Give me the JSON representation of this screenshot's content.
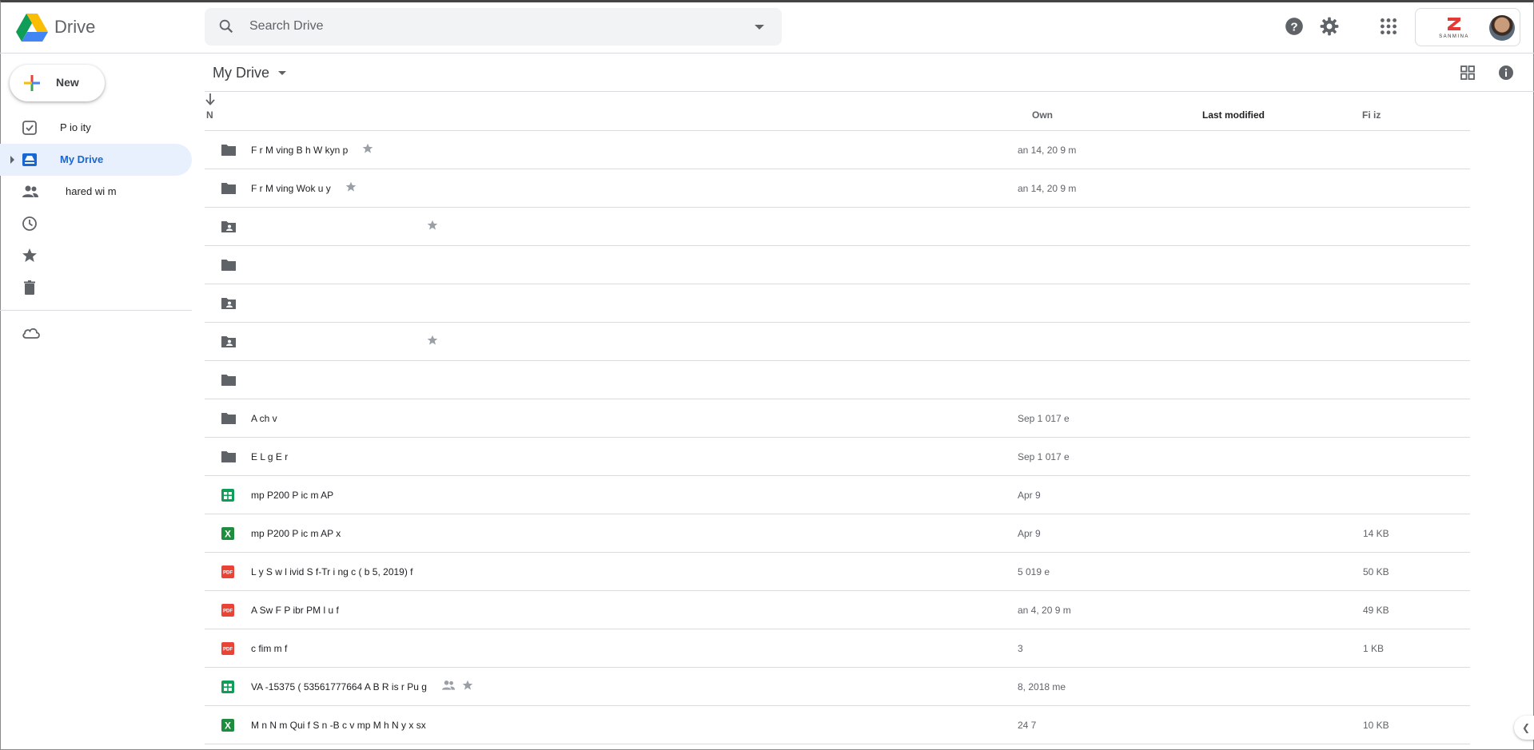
{
  "app": {
    "name": "Drive"
  },
  "search": {
    "placeholder": "Search Drive"
  },
  "header": {
    "icons": [
      "help-icon",
      "settings-icon",
      "apps-grid-icon"
    ],
    "account": {
      "org_logo_text": "SANMINA"
    }
  },
  "sidebar": {
    "new_label": "New",
    "items": [
      {
        "label": "P io ity",
        "icon": "priority-check-icon",
        "active": false
      },
      {
        "label": "My Drive",
        "icon": "my-drive-icon",
        "active": true
      },
      {
        "label": "hared wi m",
        "icon": "shared-people-icon",
        "active": false
      },
      {
        "label": "",
        "icon": "recent-clock-icon",
        "active": false
      },
      {
        "label": "",
        "icon": "starred-icon",
        "active": false
      },
      {
        "label": "",
        "icon": "trash-icon",
        "active": false
      },
      {
        "label": "",
        "icon": "storage-cloud-icon",
        "active": false
      }
    ]
  },
  "toolbar": {
    "breadcrumb": "My Drive"
  },
  "columns": {
    "name": "N",
    "owner": "Own",
    "last_modified": "Last modified",
    "file_size": "Fi iz"
  },
  "files": [
    {
      "type": "folder",
      "name": "F r M ving B h W kyn p",
      "starred": true,
      "shared": false,
      "modified": "an 14, 20 9 m",
      "size": ""
    },
    {
      "type": "folder",
      "name": "F r M ving Wok u y",
      "starred": true,
      "shared": false,
      "modified": "an 14, 20 9 m",
      "size": ""
    },
    {
      "type": "shared-folder",
      "name": "",
      "starred": true,
      "shared": false,
      "modified": "",
      "size": ""
    },
    {
      "type": "folder",
      "name": "",
      "starred": false,
      "shared": false,
      "modified": "",
      "size": ""
    },
    {
      "type": "shared-folder",
      "name": "",
      "starred": false,
      "shared": false,
      "modified": "",
      "size": ""
    },
    {
      "type": "shared-folder",
      "name": "",
      "starred": true,
      "shared": false,
      "modified": "",
      "size": ""
    },
    {
      "type": "folder",
      "name": "",
      "starred": false,
      "shared": false,
      "modified": "",
      "size": ""
    },
    {
      "type": "folder",
      "name": "A ch v",
      "starred": false,
      "shared": false,
      "modified": "Sep 1 017 e",
      "size": ""
    },
    {
      "type": "folder",
      "name": "E L g E r",
      "starred": false,
      "shared": false,
      "modified": "Sep 1 017 e",
      "size": ""
    },
    {
      "type": "sheets",
      "name": "mp P200 P ic m AP",
      "starred": false,
      "shared": false,
      "modified": "Apr 9",
      "size": ""
    },
    {
      "type": "excel",
      "name": "mp P200 P ic m AP x",
      "starred": false,
      "shared": false,
      "modified": "Apr 9",
      "size": "14 KB"
    },
    {
      "type": "pdf",
      "name": "L y S w l ivid S f-Tr i ng c ( b 5, 2019) f",
      "starred": false,
      "shared": false,
      "modified": "5 019 e",
      "size": "50 KB"
    },
    {
      "type": "pdf",
      "name": "A Sw F P ibr PM l u f",
      "starred": false,
      "shared": false,
      "modified": "an 4, 20 9 m",
      "size": "49 KB"
    },
    {
      "type": "pdf",
      "name": "c fim m f",
      "starred": false,
      "shared": false,
      "modified": "3",
      "size": "1 KB"
    },
    {
      "type": "sheets",
      "name": "VA -15375 ( 53561777664 A B R is r Pu g",
      "starred": true,
      "shared": true,
      "modified": "8, 2018 me",
      "size": ""
    },
    {
      "type": "excel",
      "name": "M n N m Qui f S n -B c v mp M h N y x sx",
      "starred": false,
      "shared": false,
      "modified": "24 7",
      "size": "10 KB"
    }
  ],
  "colors": {
    "accent": "#1967d2",
    "active_bg": "#e8f0fe",
    "folder": "#5f6368",
    "sheets": "#0f9d58",
    "pdf": "#ea4335",
    "excel": "#1e8e3e"
  }
}
